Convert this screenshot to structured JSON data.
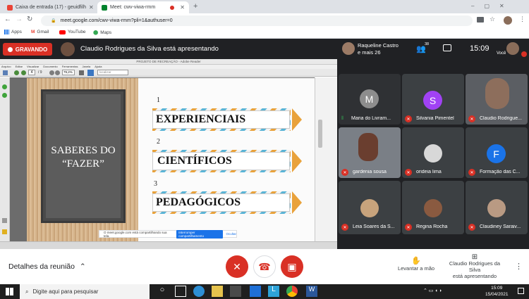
{
  "browser": {
    "tabs": [
      {
        "label": "Caixa de entrada (17) - geuidfilh",
        "active": false
      },
      {
        "label": "Meet: cwv-viwa-rmm",
        "active": true
      }
    ],
    "url": "meet.google.com/cwv-viwa-rmm?pli=1&authuser=0",
    "bookmarks": [
      "Apps",
      "Gmail",
      "YouTube",
      "Maps"
    ]
  },
  "meet": {
    "recording_label": "GRAVANDO",
    "presenting_text": "Claudio Rodrigues da Silva está apresentando",
    "participants_header_name": "Raqueline Castro",
    "participants_header_more": "e mais 26",
    "participant_count": "38",
    "time": "15:09",
    "self_label": "Você",
    "participants": [
      {
        "name": "Maria do Livram...",
        "letter": "M",
        "color": "#8d8d8d"
      },
      {
        "name": "Silvania Pimentel",
        "letter": "S",
        "color": "#a142f4"
      },
      {
        "name": "Claudio Rodrigue..."
      },
      {
        "name": "gardenia sousa"
      },
      {
        "name": "orideia lima"
      },
      {
        "name": "Formação das C...",
        "letter": "F",
        "color": "#1a73e8"
      },
      {
        "name": "Leia Soares da S..."
      },
      {
        "name": "Regina Rocha"
      },
      {
        "name": "Claudiney Saraiv..."
      }
    ],
    "bottom": {
      "details_label": "Detalhes da reunião",
      "raise_hand_label": "Levantar a mão",
      "presenter_line1": "Claudio Rodrigues da Silva",
      "presenter_line2": "está apresentando"
    }
  },
  "shared_screen": {
    "reader_title": "PROJETO DE RECREAÇÃO - Adobe Reader",
    "menu": [
      "Arquivo",
      "Editar",
      "Visualizar",
      "Documento",
      "Ferramentas",
      "Janela",
      "Ajuda"
    ],
    "page_current": "4",
    "page_total": "/ 9",
    "zoom": "79,2%",
    "search_placeholder": "localizar",
    "slide": {
      "board_line1": "SABERES DO",
      "board_line2": "“FAZER”",
      "items": [
        {
          "number": "1",
          "label": "EXPERIENCIAIS"
        },
        {
          "number": "2",
          "label": "CIENTÍFICOS"
        },
        {
          "number": "3",
          "label": "PEDAGÓGICOS"
        }
      ]
    },
    "share_notice": "O meet.google.com está compartilhando sua tela.",
    "share_stop": "Interromper compartilhamento",
    "share_hide": "Ocultar"
  },
  "taskbar": {
    "search_placeholder": "Digite aqui para pesquisar",
    "time": "15:09",
    "date": "15/04/2021"
  }
}
